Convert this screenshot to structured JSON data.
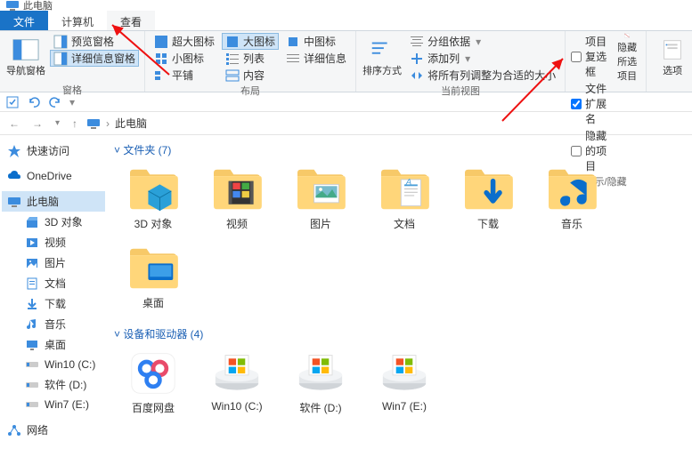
{
  "window_title": "此电脑",
  "tabs": {
    "file": "文件",
    "computer": "计算机",
    "view": "查看"
  },
  "ribbon": {
    "panes": {
      "nav": "导航窗格",
      "preview": "预览窗格",
      "details": "详细信息窗格",
      "group": "窗格"
    },
    "layout": {
      "xl": "超大图标",
      "l": "大图标",
      "m": "中图标",
      "s": "小图标",
      "list": "列表",
      "detail": "详细信息",
      "tile": "平铺",
      "content": "内容",
      "group": "布局"
    },
    "current": {
      "sort": "排序方式",
      "groupby": "分组依据",
      "addcol": "添加列",
      "fitcols": "将所有列调整为合适的大小",
      "group": "当前视图"
    },
    "showhide": {
      "itemcheck": "项目复选框",
      "ext": "文件扩展名",
      "hidden": "隐藏的项目",
      "hidebtn": "隐藏所选项目",
      "group": "显示/隐藏"
    },
    "options": "选项"
  },
  "breadcrumb": {
    "pc": "此电脑"
  },
  "sidebar": {
    "quick": "快速访问",
    "onedrive": "OneDrive",
    "pc": "此电脑",
    "items": [
      "3D 对象",
      "视频",
      "图片",
      "文档",
      "下载",
      "音乐",
      "桌面",
      "Win10 (C:)",
      "软件 (D:)",
      "Win7 (E:)"
    ],
    "network": "网络"
  },
  "sections": {
    "folders": "文件夹 (7)",
    "drives": "设备和驱动器 (4)"
  },
  "folders": [
    "3D 对象",
    "视频",
    "图片",
    "文档",
    "下载",
    "音乐",
    "桌面"
  ],
  "drives": [
    "百度网盘",
    "Win10 (C:)",
    "软件 (D:)",
    "Win7 (E:)"
  ]
}
